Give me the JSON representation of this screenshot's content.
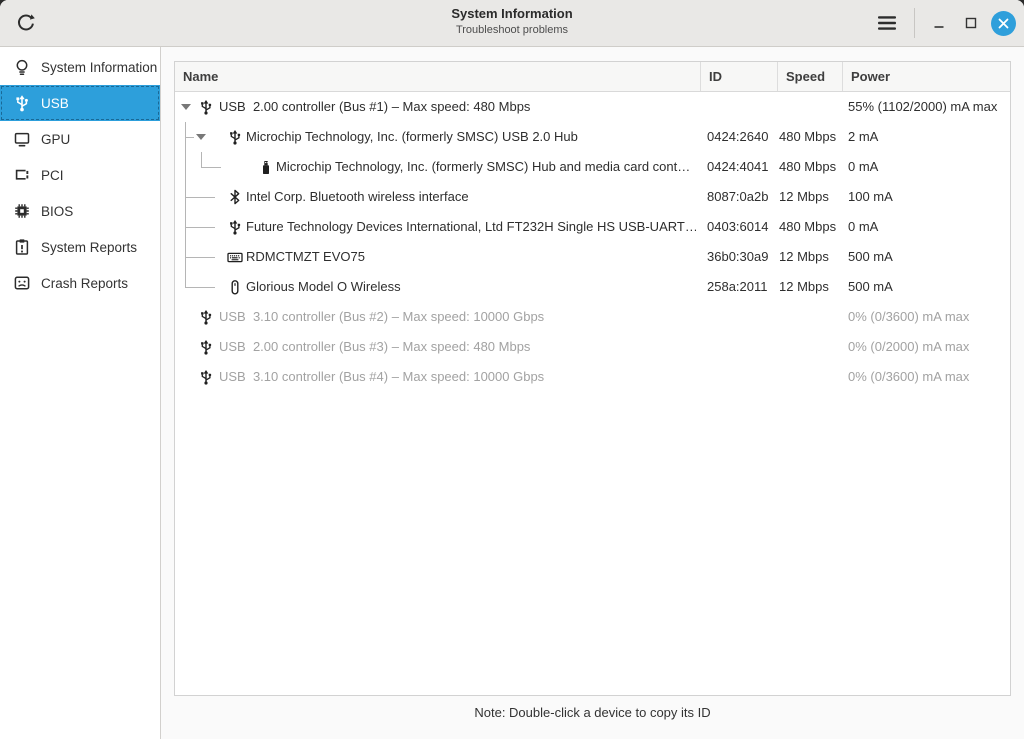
{
  "titlebar": {
    "title": "System Information",
    "subtitle": "Troubleshoot problems"
  },
  "colors": {
    "accent_blue": "#2d9fdb",
    "titlebar_bg": "#e9e8e6",
    "content_bg": "#fafafa",
    "dim_text": "#a2a2a2"
  },
  "sidebar": {
    "items": [
      {
        "label": "System Information",
        "icon": "lightbulb-icon",
        "selected": false
      },
      {
        "label": "USB",
        "icon": "usb-icon",
        "selected": true
      },
      {
        "label": "GPU",
        "icon": "monitor-icon",
        "selected": false
      },
      {
        "label": "PCI",
        "icon": "pci-card-icon",
        "selected": false
      },
      {
        "label": "BIOS",
        "icon": "chip-icon",
        "selected": false
      },
      {
        "label": "System Reports",
        "icon": "clipboard-icon",
        "selected": false
      },
      {
        "label": "Crash Reports",
        "icon": "crash-face-icon",
        "selected": false
      }
    ]
  },
  "table": {
    "columns": [
      "Name",
      "ID",
      "Speed",
      "Power"
    ],
    "rows": [
      {
        "name": "USB  2.00 controller (Bus #1) – Max speed: 480 Mbps",
        "id": "",
        "speed": "",
        "power": "55% (1102/2000) mA max",
        "icon": "usb-icon",
        "level": 0,
        "expanded": true,
        "dimmed": false
      },
      {
        "name": "Microchip Technology, Inc. (formerly SMSC) USB 2.0 Hub",
        "id": "0424:2640",
        "speed": "480 Mbps",
        "power": "2 mA",
        "icon": "usb-icon",
        "level": 1,
        "expanded": true,
        "dimmed": false
      },
      {
        "name": "Microchip Technology, Inc. (formerly SMSC) Hub and media card cont…",
        "id": "0424:4041",
        "speed": "480 Mbps",
        "power": "0 mA",
        "icon": "flash-drive-icon",
        "level": 2,
        "expanded": false,
        "dimmed": false
      },
      {
        "name": "Intel Corp. Bluetooth wireless interface",
        "id": "8087:0a2b",
        "speed": "12 Mbps",
        "power": "100 mA",
        "icon": "bluetooth-icon",
        "level": 1,
        "expanded": false,
        "dimmed": false
      },
      {
        "name": "Future Technology Devices International, Ltd FT232H Single HS USB-UART…",
        "id": "0403:6014",
        "speed": "480 Mbps",
        "power": "0 mA",
        "icon": "usb-icon",
        "level": 1,
        "expanded": false,
        "dimmed": false
      },
      {
        "name": "RDMCTMZT EVO75",
        "id": "36b0:30a9",
        "speed": "12 Mbps",
        "power": "500 mA",
        "icon": "keyboard-icon",
        "level": 1,
        "expanded": false,
        "dimmed": false
      },
      {
        "name": "Glorious Model O Wireless",
        "id": "258a:2011",
        "speed": "12 Mbps",
        "power": "500 mA",
        "icon": "mouse-icon",
        "level": 1,
        "expanded": false,
        "dimmed": false
      },
      {
        "name": "USB  3.10 controller (Bus #2) – Max speed: 10000 Gbps",
        "id": "",
        "speed": "",
        "power": "0% (0/3600) mA max",
        "icon": "usb-icon",
        "level": 0,
        "expanded": false,
        "dimmed": true
      },
      {
        "name": "USB  2.00 controller (Bus #3) – Max speed: 480 Mbps",
        "id": "",
        "speed": "",
        "power": "0% (0/2000) mA max",
        "icon": "usb-icon",
        "level": 0,
        "expanded": false,
        "dimmed": true
      },
      {
        "name": "USB  3.10 controller (Bus #4) – Max speed: 10000 Gbps",
        "id": "",
        "speed": "",
        "power": "0% (0/3600) mA max",
        "icon": "usb-icon",
        "level": 0,
        "expanded": false,
        "dimmed": true
      }
    ]
  },
  "footer": {
    "note": "Note: Double-click a device to copy its ID"
  }
}
